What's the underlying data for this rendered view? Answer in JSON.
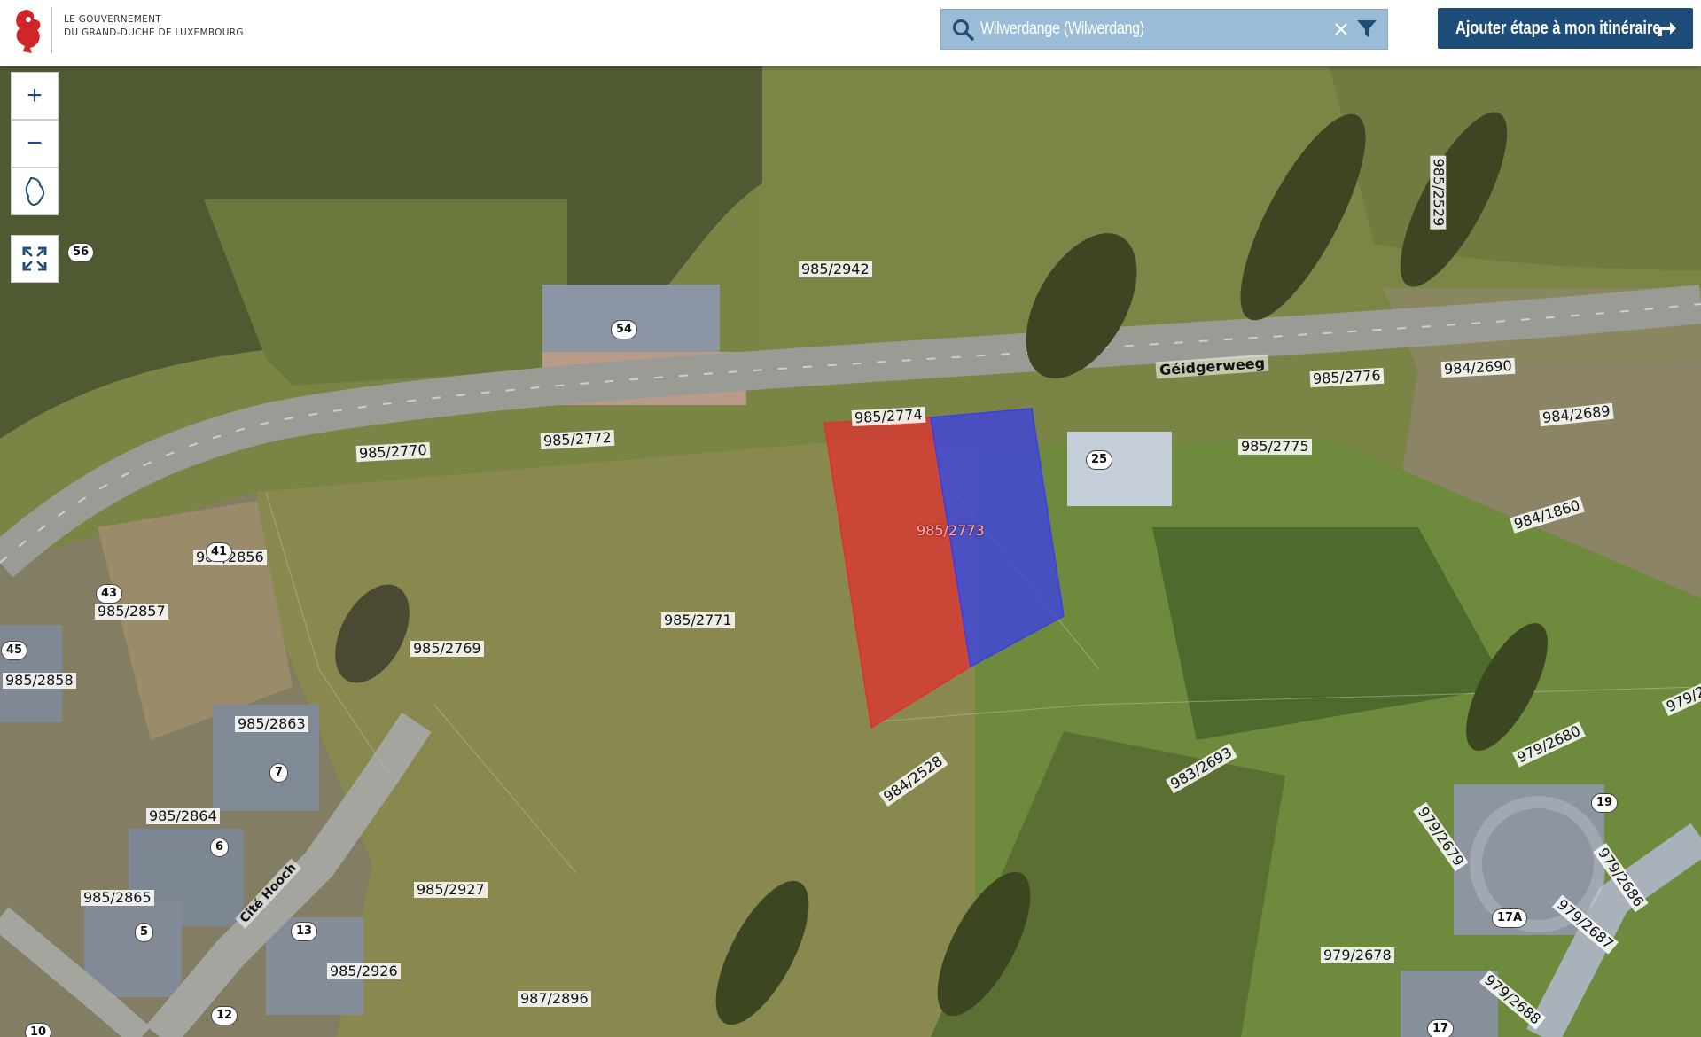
{
  "header": {
    "logo_line1": "LE GOUVERNEMENT",
    "logo_line2": "DU GRAND-DUCHÉ DE LUXEMBOURG",
    "search_value": "Wilwerdange (Wilwerdang)",
    "route_button": "Ajouter étape à mon itinéraire"
  },
  "colors": {
    "brand": "#1f4d79",
    "search_bg": "#9bbcd6",
    "parcel_red": "#e0302f",
    "parcel_blue": "#3a3ee8"
  },
  "controls": [
    "zoom-in",
    "zoom-out",
    "country-extent",
    "fullscreen"
  ],
  "map": {
    "street_name": "Géidgerweeg",
    "street_name2": "Cité Hooch",
    "selected_parcel": "985/2773",
    "parcel_labels": {
      "p2942": "985/2942",
      "p2529": "985/2529",
      "p2776": "985/2776",
      "p2690": "984/2690",
      "p2689": "984/2689",
      "p2774": "985/2774",
      "p2772": "985/2772",
      "p2770": "985/2770",
      "p2775": "985/2775",
      "p1860": "984/1860",
      "p2856": "985/2856",
      "p2857": "985/2857",
      "p2771": "985/2771",
      "p2769": "985/2769",
      "p2858": "985/2858",
      "p2863": "985/2863",
      "p2864": "985/2864",
      "p2865": "985/2865",
      "p2927": "985/2927",
      "p2926": "985/2926",
      "p2896": "987/2896",
      "p2528": "984/2528",
      "p2693": "983/2693",
      "p2680": "979/2680",
      "p2679": "979/2679",
      "p2686": "979/2686",
      "p2687": "979/2687",
      "p2678": "979/2678",
      "p2688": "979/2688",
      "p2edge": "979/2"
    },
    "house_numbers": {
      "n56": "56",
      "n54": "54",
      "n25": "25",
      "n41": "41",
      "n43": "43",
      "n45": "45",
      "n7": "7",
      "n6": "6",
      "n5": "5",
      "n13": "13",
      "n12": "12",
      "n19": "19",
      "n17a": "17A",
      "n17": "17",
      "n10": "10"
    }
  }
}
